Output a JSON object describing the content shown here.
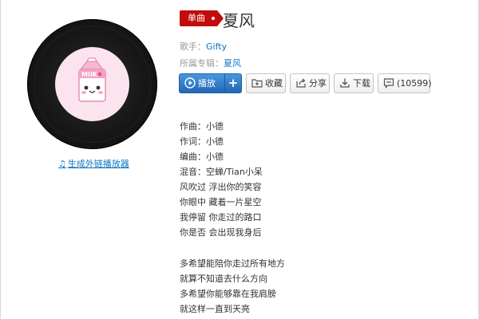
{
  "song": {
    "badge": "单曲",
    "title": "夏风",
    "artist_label": "歌手：",
    "artist": "Gifty",
    "album_label": "所属专辑：",
    "album": "夏风"
  },
  "cover": {
    "label_text": "MilK"
  },
  "player_link": "生成外链播放器",
  "buttons": {
    "play": "播放",
    "add": "+",
    "favorite": "收藏",
    "share": "分享",
    "download": "下载",
    "comments": "(10599)"
  },
  "lyrics": [
    "作曲：小德",
    "作词：小德",
    "编曲：小德",
    "混音：空蝉/Tian小呆",
    "风吹过 浮出你的笑容",
    "你眼中 藏着一片星空",
    "我停留 你走过的路口",
    "你是否 会出现我身后",
    "",
    "多希望能陪你走过所有地方",
    "就算不知道去什么方向",
    "多希望你能够靠在我肩膀",
    "就这样一直到天亮"
  ],
  "colors": {
    "accent_red": "#c20c0c",
    "link_blue": "#0c73c2",
    "play_blue": "#2a6fc0"
  },
  "icons": {
    "play": "play-circle-icon",
    "favorite": "folder-plus-icon",
    "share": "share-icon",
    "download": "download-icon",
    "comments": "speech-bubble-icon",
    "player_link": "music-note-icon"
  }
}
